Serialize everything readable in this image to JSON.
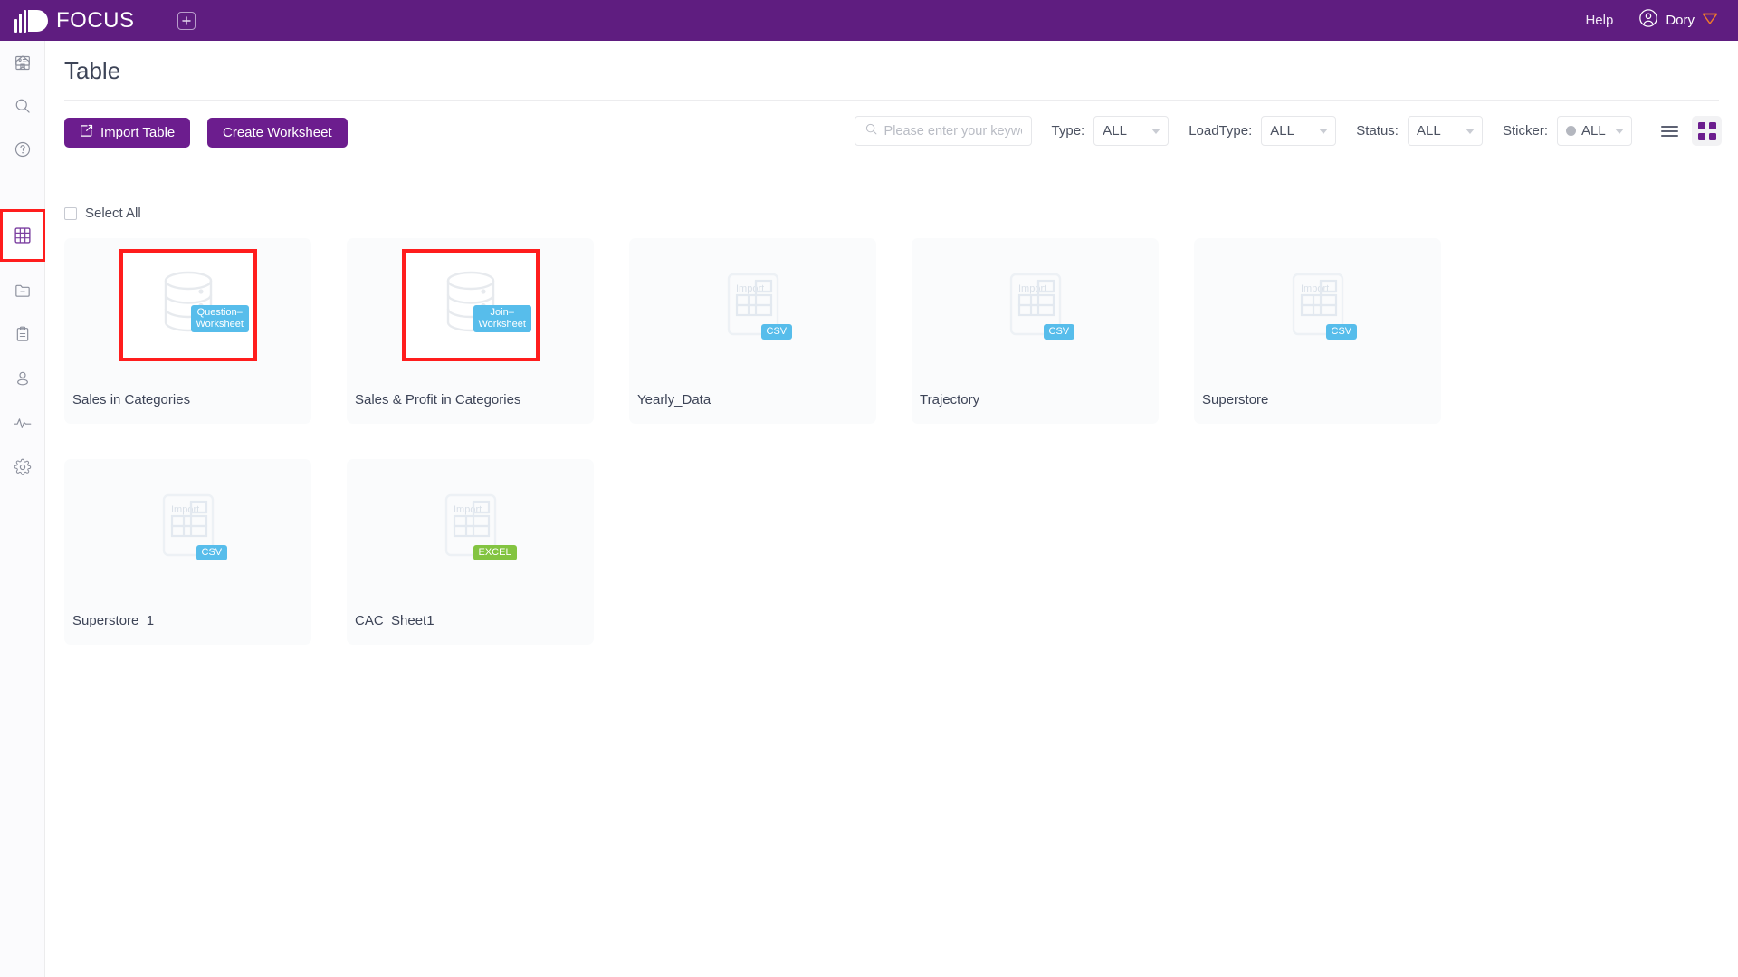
{
  "topbar": {
    "brand": "FOCUS",
    "add_tab_icon": "plus-square-icon",
    "help_label": "Help",
    "user_name": "Dory",
    "avatar_icon": "user-circle-icon",
    "gem_icon": "gem-icon",
    "bg_color": "#5f1d80"
  },
  "sidebar": {
    "items": [
      {
        "icon": "home-icon",
        "name": "sidebar-item-home",
        "active": false
      },
      {
        "icon": "search-icon",
        "name": "sidebar-item-search",
        "active": false
      },
      {
        "icon": "help-circle-icon",
        "name": "sidebar-item-help",
        "active": false
      },
      {
        "icon": "presentation-icon",
        "name": "sidebar-item-dashboard",
        "active": false
      },
      {
        "icon": "table-grid-icon",
        "name": "sidebar-item-table",
        "active": true
      },
      {
        "icon": "folder-minus-icon",
        "name": "sidebar-item-folder",
        "active": false
      },
      {
        "icon": "clipboard-icon",
        "name": "sidebar-item-clipboard",
        "active": false
      },
      {
        "icon": "user-icon",
        "name": "sidebar-item-user",
        "active": false
      },
      {
        "icon": "activity-icon",
        "name": "sidebar-item-activity",
        "active": false
      },
      {
        "icon": "gear-icon",
        "name": "sidebar-item-settings",
        "active": false
      }
    ],
    "highlight_color": "#ff1d1d"
  },
  "page": {
    "title": "Table"
  },
  "toolbar": {
    "import_table_label": "Import Table",
    "import_icon": "import-arrow-icon",
    "create_worksheet_label": "Create Worksheet",
    "button_color": "#6c1d8e"
  },
  "search": {
    "placeholder": "Please enter your keywo",
    "value": "",
    "icon": "search-icon"
  },
  "filters": [
    {
      "label": "Type:",
      "value": "ALL",
      "name": "filter-type",
      "dot": false
    },
    {
      "label": "LoadType:",
      "value": "ALL",
      "name": "filter-loadtype",
      "dot": false
    },
    {
      "label": "Status:",
      "value": "ALL",
      "name": "filter-status",
      "dot": false
    },
    {
      "label": "Sticker:",
      "value": "ALL",
      "name": "filter-sticker",
      "dot": true
    }
  ],
  "view_toggle": {
    "list_icon": "list-view-icon",
    "grid_icon": "grid-view-icon",
    "active": "grid"
  },
  "select_all": {
    "label": "Select All",
    "checked": false
  },
  "cards": [
    {
      "title": "Sales in Categories",
      "icon": "database-cylinder-icon",
      "badge": "Question-\nWorksheet",
      "badge_line1": "Question–",
      "badge_line2": "Worksheet",
      "badge_color": "blue",
      "highlighted": true
    },
    {
      "title": "Sales & Profit in Categories",
      "icon": "database-cylinder-icon",
      "badge_line1": "Join–",
      "badge_line2": "Worksheet",
      "badge_color": "blue",
      "highlighted": true
    },
    {
      "title": "Yearly_Data",
      "icon": "import-table-file-icon",
      "badge_line1": "CSV",
      "badge_line2": "",
      "badge_color": "blue",
      "highlighted": false
    },
    {
      "title": "Trajectory",
      "icon": "import-table-file-icon",
      "badge_line1": "CSV",
      "badge_line2": "",
      "badge_color": "blue",
      "highlighted": false
    },
    {
      "title": "Superstore",
      "icon": "import-table-file-icon",
      "badge_line1": "CSV",
      "badge_line2": "",
      "badge_color": "blue",
      "highlighted": false
    },
    {
      "title": "Superstore_1",
      "icon": "import-table-file-icon",
      "badge_line1": "CSV",
      "badge_line2": "",
      "badge_color": "blue",
      "highlighted": false
    },
    {
      "title": "CAC_Sheet1",
      "icon": "import-table-file-icon",
      "badge_line1": "EXCEL",
      "badge_line2": "",
      "badge_color": "green",
      "highlighted": false
    }
  ],
  "icon_label_import": "Import"
}
